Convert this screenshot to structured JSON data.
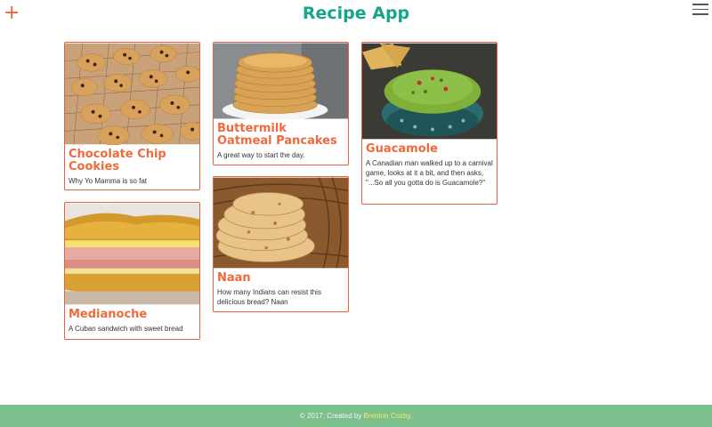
{
  "header": {
    "add_label": "+",
    "title": "Recipe App",
    "menu_icon": "hamburger-menu-icon"
  },
  "recipes": [
    {
      "name": "Chocolate Chip Cookies",
      "description": "Why Yo Mamma is so fat"
    },
    {
      "name": "Buttermilk Oatmeal Pancakes",
      "description": "A great way to start the day."
    },
    {
      "name": "Guacamole",
      "description": "A Canadian man walked up to a carnival game, looks at it a bit, and then asks, \"...So all you gotta do is Guacamole?\""
    },
    {
      "name": "Medianoche",
      "description": "A Cuban sandwich with sweet bread"
    },
    {
      "name": "Naan",
      "description": "How many Indians can resist this delicious bread? Naan"
    }
  ],
  "footer": {
    "prefix": "© 2017. Created by",
    "author": "Brenton Cozby",
    "suffix": "."
  },
  "colors": {
    "title": "#17a589",
    "accent": "#ee6a3c",
    "footer_bg": "#7cc08e",
    "footer_link": "#f5e86a"
  }
}
